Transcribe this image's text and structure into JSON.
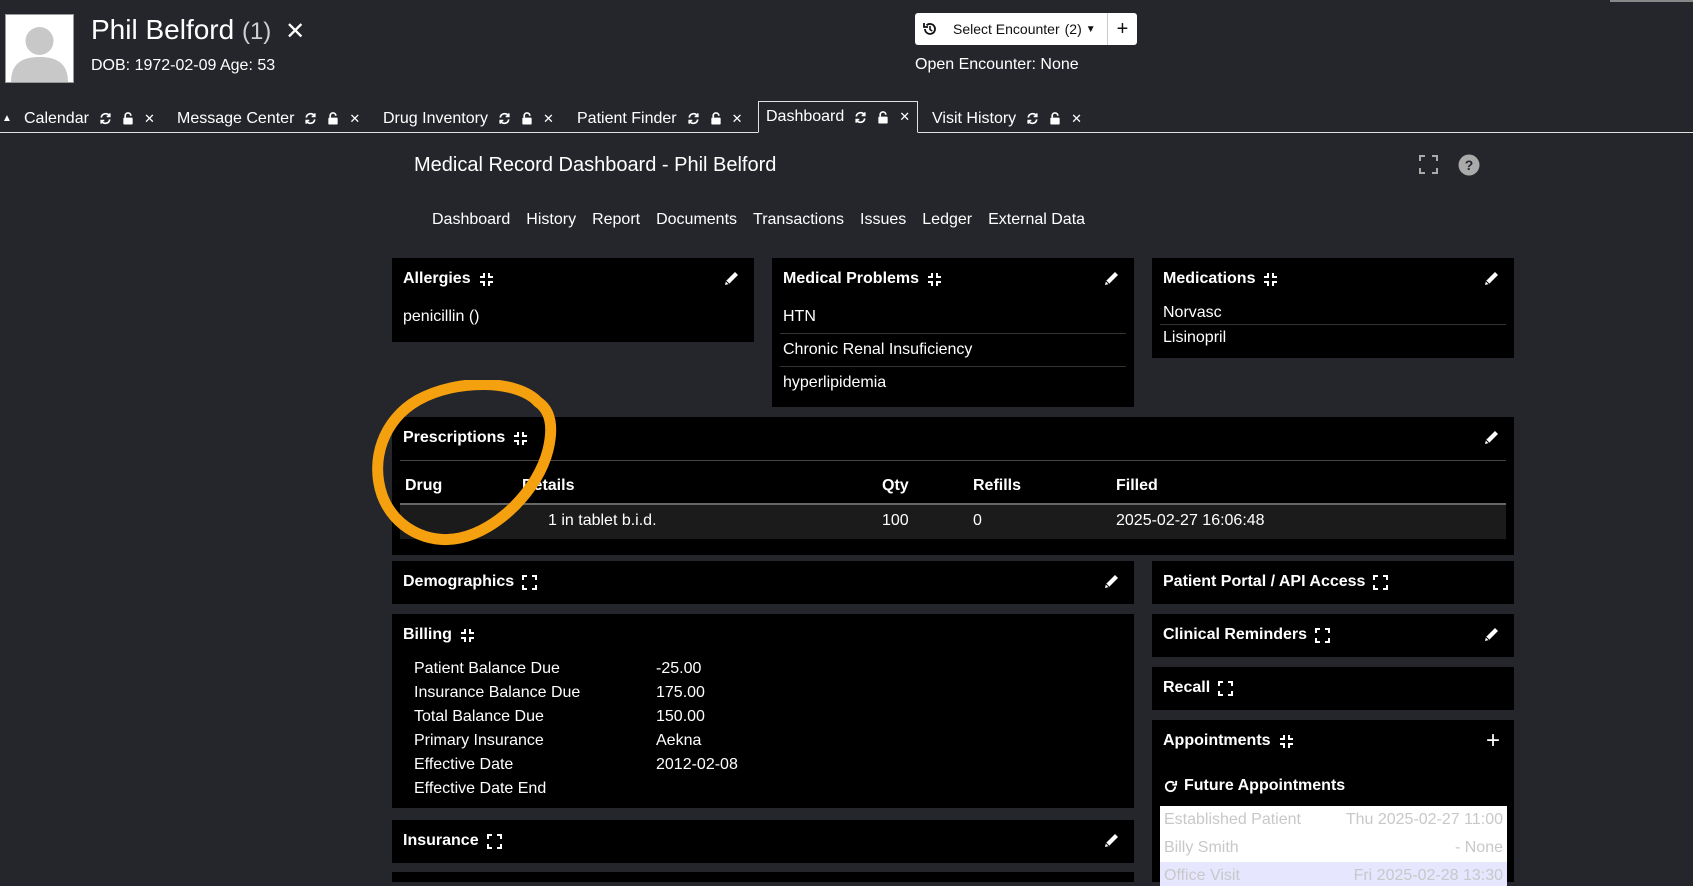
{
  "patient": {
    "name": "Phil Belford",
    "count": "(1)",
    "dob_line": "DOB: 1972-02-09 Age: 53"
  },
  "encounter": {
    "select_label": "Select Encounter",
    "select_count": "(2)",
    "open_label": "Open Encounter: None"
  },
  "tabs": [
    {
      "label": "Calendar"
    },
    {
      "label": "Message Center"
    },
    {
      "label": "Drug Inventory"
    },
    {
      "label": "Patient Finder"
    },
    {
      "label": "Dashboard"
    },
    {
      "label": "Visit History"
    }
  ],
  "dashboard": {
    "title": "Medical Record Dashboard - Phil Belford",
    "nav": [
      "Dashboard",
      "History",
      "Report",
      "Documents",
      "Transactions",
      "Issues",
      "Ledger",
      "External Data"
    ]
  },
  "allergies": {
    "title": "Allergies",
    "items": [
      "penicillin ()"
    ]
  },
  "medical_problems": {
    "title": "Medical Problems",
    "items": [
      "HTN",
      "Chronic Renal Insuficiency",
      "hyperlipidemia"
    ]
  },
  "medications": {
    "title": "Medications",
    "items": [
      "Norvasc",
      "Lisinopril"
    ]
  },
  "prescriptions": {
    "title": "Prescriptions",
    "columns": [
      "Drug",
      "Details",
      "Qty",
      "Refills",
      "Filled"
    ],
    "rows": [
      {
        "drug": "",
        "details": "1 in tablet b.i.d.",
        "qty": "100",
        "refills": "0",
        "filled": "2025-02-27 16:06:48"
      }
    ]
  },
  "demographics": {
    "title": "Demographics"
  },
  "billing": {
    "title": "Billing",
    "rows": [
      {
        "label": "Patient Balance Due",
        "value": "-25.00"
      },
      {
        "label": "Insurance Balance Due",
        "value": "175.00"
      },
      {
        "label": "Total Balance Due",
        "value": "150.00"
      },
      {
        "label": "Primary Insurance",
        "value": "Aekna"
      },
      {
        "label": "Effective Date",
        "value": "2012-02-08"
      },
      {
        "label": "Effective Date End",
        "value": ""
      }
    ]
  },
  "insurance": {
    "title": "Insurance"
  },
  "portal": {
    "title": "Patient Portal / API Access"
  },
  "reminders": {
    "title": "Clinical Reminders"
  },
  "recall": {
    "title": "Recall"
  },
  "appointments": {
    "title": "Appointments",
    "future_title": "Future Appointments",
    "rows": [
      {
        "left": "Established Patient",
        "right": "Thu 2025-02-27 11:00"
      },
      {
        "left": "Billy Smith",
        "right": "- None"
      },
      {
        "left": "Office Visit",
        "right": "Fri 2025-02-28 13:30"
      }
    ]
  },
  "colors": {
    "background": "#24262b",
    "card": "#000000",
    "annotation": "#f5a00f"
  }
}
